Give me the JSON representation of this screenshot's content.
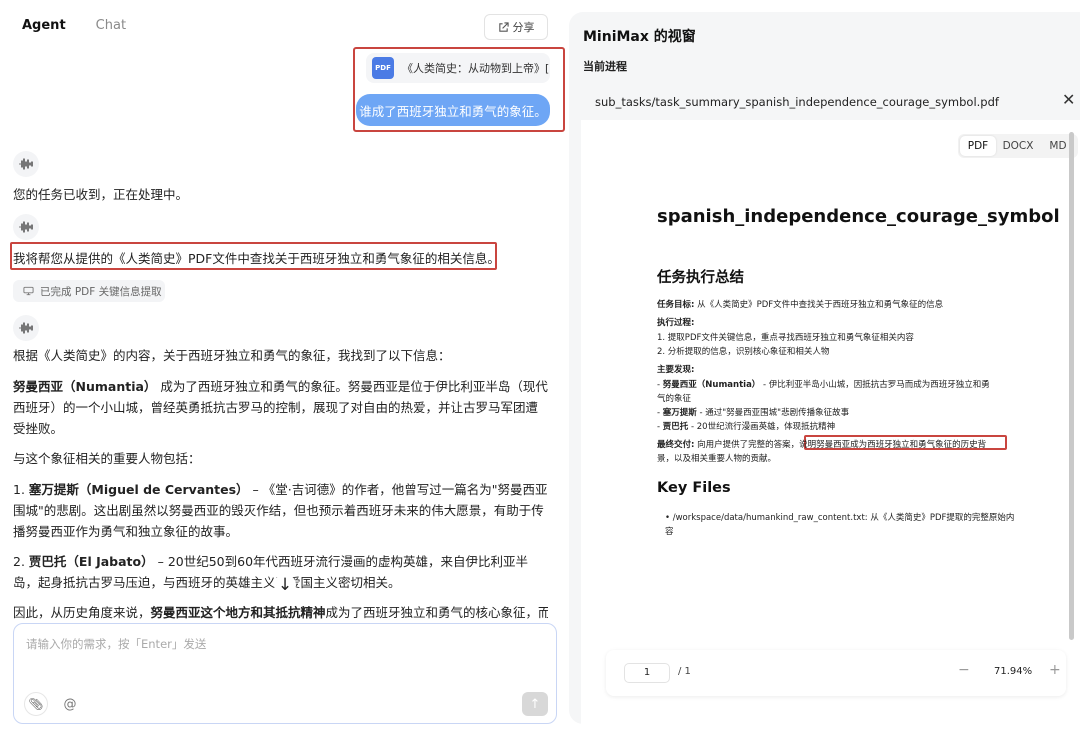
{
  "tabs": {
    "agent": "Agent",
    "chat": "Chat"
  },
  "share_label": "分享",
  "user": {
    "file_name": "《人类简史：从动物到上帝》[...",
    "file_type": "PDF",
    "message": "谁成了西班牙独立和勇气的象征。"
  },
  "agent": {
    "received": "您的任务已收到，正在处理中。",
    "plan": "我将帮您从提供的《人类简史》PDF文件中查找关于西班牙独立和勇气象征的相关信息。",
    "status": "已完成 PDF 关键信息提取",
    "intro": "根据《人类简史》的内容，关于西班牙独立和勇气的象征，我找到了以下信息：",
    "p1_bold": "努曼西亚（Numantia）",
    "p1_rest": " 成为了西班牙独立和勇气的象征。努曼西亚是位于伊比利亚半岛（现代西班牙）的一个小山城，曾经英勇抵抗古罗马的控制，展现了对自由的热爱，并让古罗马军团遭受挫败。",
    "p2": "与这个象征相关的重要人物包括：",
    "p3_num": "1. ",
    "p3_bold": "塞万提斯（Miguel de Cervantes）",
    "p3_rest": " – 《堂·吉诃德》的作者，他曾写过一篇名为\"努曼西亚围城\"的悲剧。这出剧虽然以努曼西亚的毁灭作结，但也预示着西班牙未来的伟大愿景，有助于传播努曼西亚作为勇气和独立象征的故事。",
    "p4_num": "2. ",
    "p4_bold": "贾巴托（El Jabato）",
    "p4_rest": " – 20世纪50到60年代西班牙流行漫画的虚构英雄，来自伊比利亚半岛，起身抵抗古罗马压迫，与西班牙的英雄主义和爱国主义密切相关。",
    "p5_pre": "因此，从历史角度来说，",
    "p5_bold": "努曼西亚这个地方和其抵抗精神",
    "p5_rest": "成为了西班牙独立和勇气的核心象征，而"
  },
  "input": {
    "placeholder": "请输入你的需求，按「Enter」发送"
  },
  "right": {
    "title": "MiniMax 的视窗",
    "current_process": "当前进程",
    "file_path": "sub_tasks/task_summary_spanish_independence_courage_symbol.pdf",
    "formats": [
      "PDF",
      "DOCX",
      "MD"
    ],
    "doc": {
      "title": "spanish_independence_courage_symbol",
      "h_summary": "任务执行总结",
      "goal_label": "任务目标:",
      "goal_text": " 从《人类简史》PDF文件中查找关于西班牙独立和勇气象征的信息",
      "process_label": "执行过程:",
      "process_1": "1. 提取PDF文件关键信息，重点寻找西班牙独立和勇气象征相关内容",
      "process_2": "2. 分析提取的信息，识别核心象征和相关人物",
      "findings_label": "主要发现:",
      "finding_1_bold": "努曼西亚（Numantia）",
      "finding_1_rest": " - 伊比利亚半岛小山城，因抵抗古罗马而成为西班牙独立和勇",
      "finding_1_cont": "气的象征",
      "finding_2_bold": "塞万提斯",
      "finding_2_rest": " - 通过\"努曼西亚围城\"悲剧传播象征故事",
      "finding_3_bold": "贾巴托",
      "finding_3_rest": " - 20世纪流行漫画英雄，体现抵抗精神",
      "delivery_label": "最终交付:",
      "delivery_text": " 向用户提供了完整的答案，说明努曼西亚成为西班牙独立和勇气象征的历史背",
      "delivery_cont": "景，以及相关重要人物的贡献。",
      "h_files": "Key Files",
      "file_item": "/workspace/data/humankind_raw_content.txt: 从《人类简史》PDF提取的完整原始内容"
    },
    "pager": {
      "page": "1",
      "total": "/ 1",
      "zoom": "71.94%"
    }
  }
}
